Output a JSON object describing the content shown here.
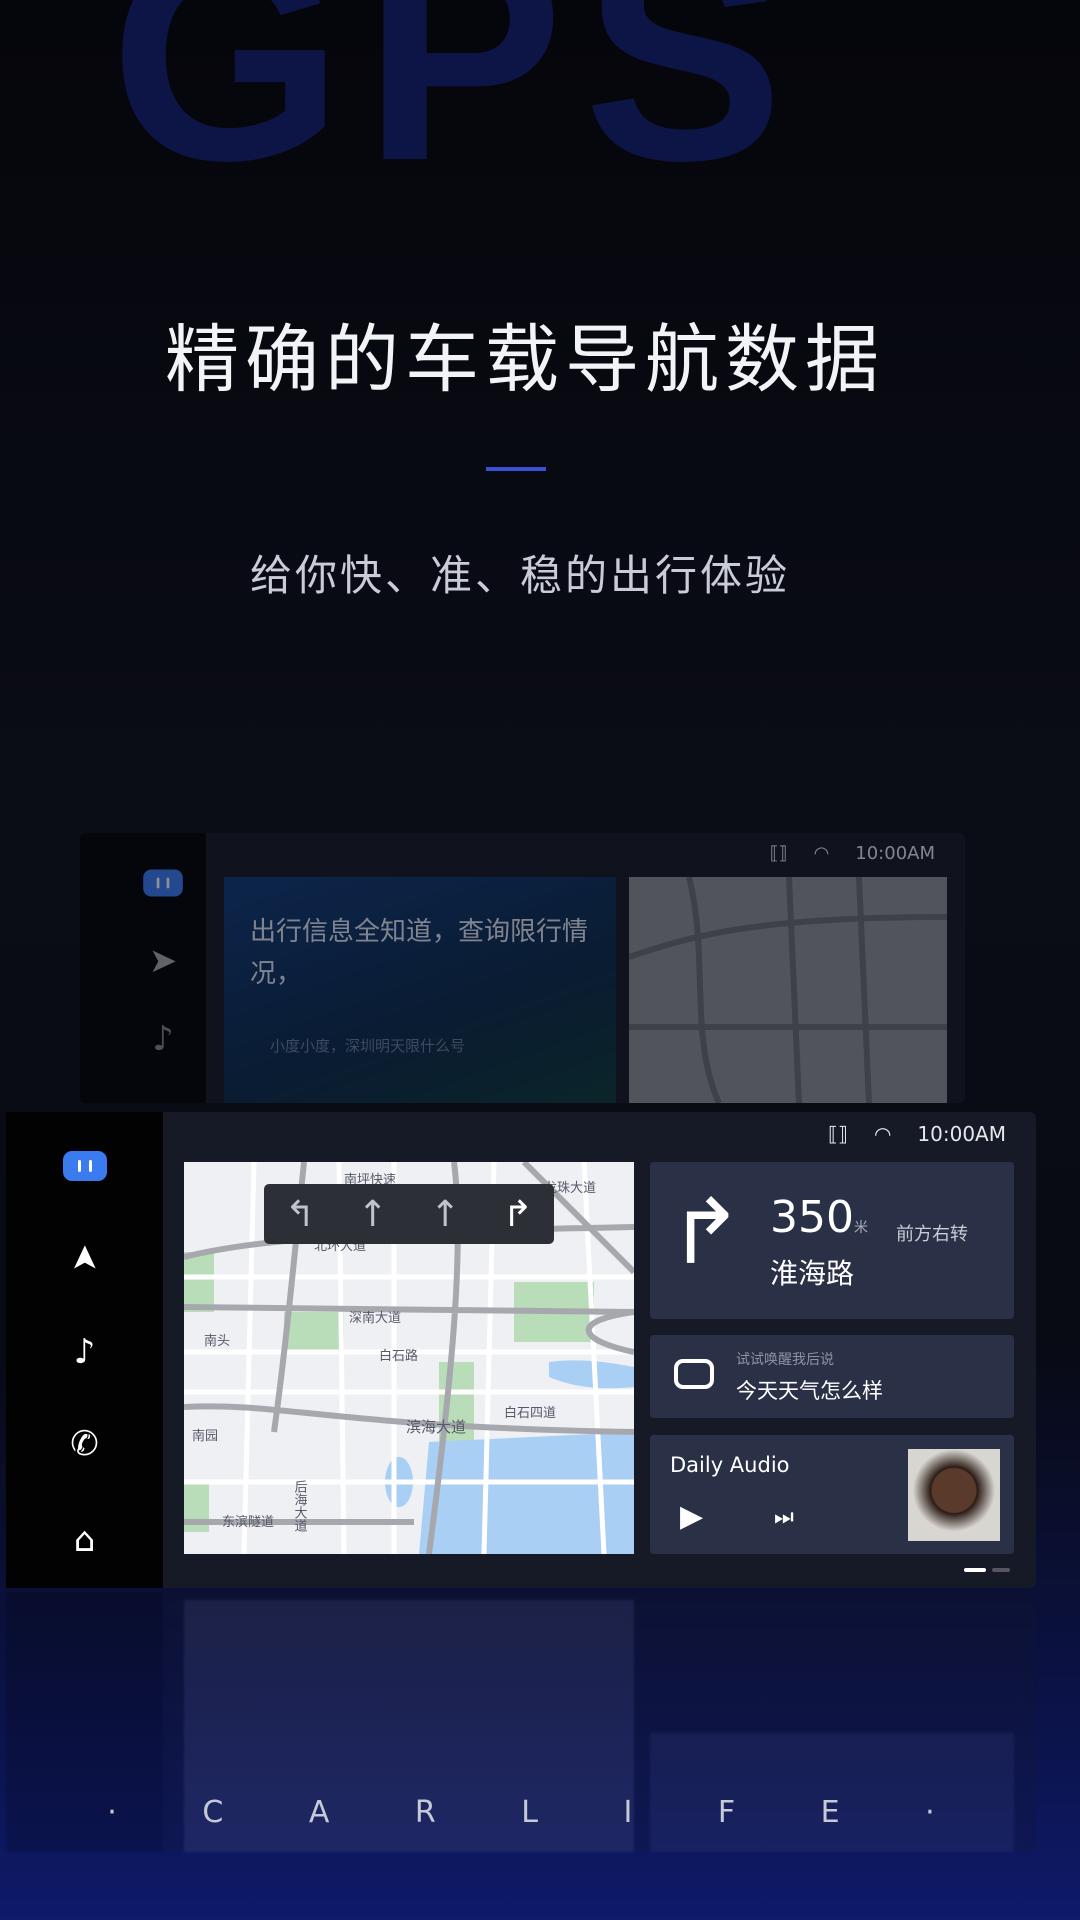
{
  "hero": {
    "watermark": "GPS",
    "title": "精确的车载导航数据",
    "subtitle": "给你快、准、稳的出行体验",
    "brand": "· C A R L I F E ·"
  },
  "colors": {
    "accent": "#3a4fd8",
    "voice_button": "#3a7bf0",
    "card": "#2a3146",
    "panel": "#161a26"
  },
  "status_bar": {
    "time": "10:00AM",
    "icons": [
      "carlife-connect-icon",
      "wifi-icon"
    ]
  },
  "sidebar": {
    "items": [
      {
        "icon": "voice-assistant-icon"
      },
      {
        "icon": "navigation-icon"
      },
      {
        "icon": "music-icon"
      },
      {
        "icon": "phone-icon"
      },
      {
        "icon": "home-icon"
      }
    ]
  },
  "ghost_screen": {
    "headline": "出行信息全知道，查询限行情况，",
    "hint": "小度小度，深圳明天限什么号",
    "time": "10:00AM"
  },
  "map": {
    "labels": [
      "南坪快速",
      "龙珠大道",
      "北环大道",
      "深南大道",
      "南头",
      "白石路",
      "白石四道",
      "滨海大道",
      "南园",
      "后海大道",
      "东滨隧道"
    ],
    "lanes": [
      "left",
      "straight",
      "straight",
      "right"
    ]
  },
  "navigation": {
    "distance": "350",
    "unit": "米",
    "action": "前方右转",
    "road": "淮海路"
  },
  "voice_card": {
    "hint": "试试唤醒我后说",
    "query": "今天天气怎么样"
  },
  "media": {
    "title": "Daily Audio",
    "state": "paused"
  },
  "pager": {
    "page": 1,
    "total": 2
  }
}
